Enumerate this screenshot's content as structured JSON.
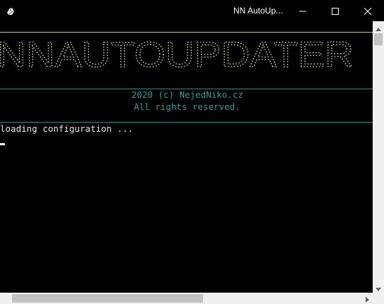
{
  "window": {
    "title": "NN AutoUp...",
    "icon": "console-app-icon"
  },
  "controls": {
    "minimize_icon": "minimize-icon",
    "maximize_icon": "maximize-icon",
    "close_icon": "close-icon"
  },
  "console": {
    "banner_text": "NNAUTOUPDATER",
    "credit_line_1": "2020 (c) NejedNiko.cz",
    "credit_line_2": "All rights reserved.",
    "log_line": "loading configuration ...",
    "colors": {
      "background": "#000000",
      "banner": "#c8c8a0",
      "credit": "#3a9a9a",
      "log": "#e6e6e6"
    }
  },
  "scrollbars": {
    "vertical_up_icon": "arrow-up-icon",
    "vertical_down_icon": "arrow-down-icon",
    "horizontal_right_icon": "arrow-right-icon"
  }
}
